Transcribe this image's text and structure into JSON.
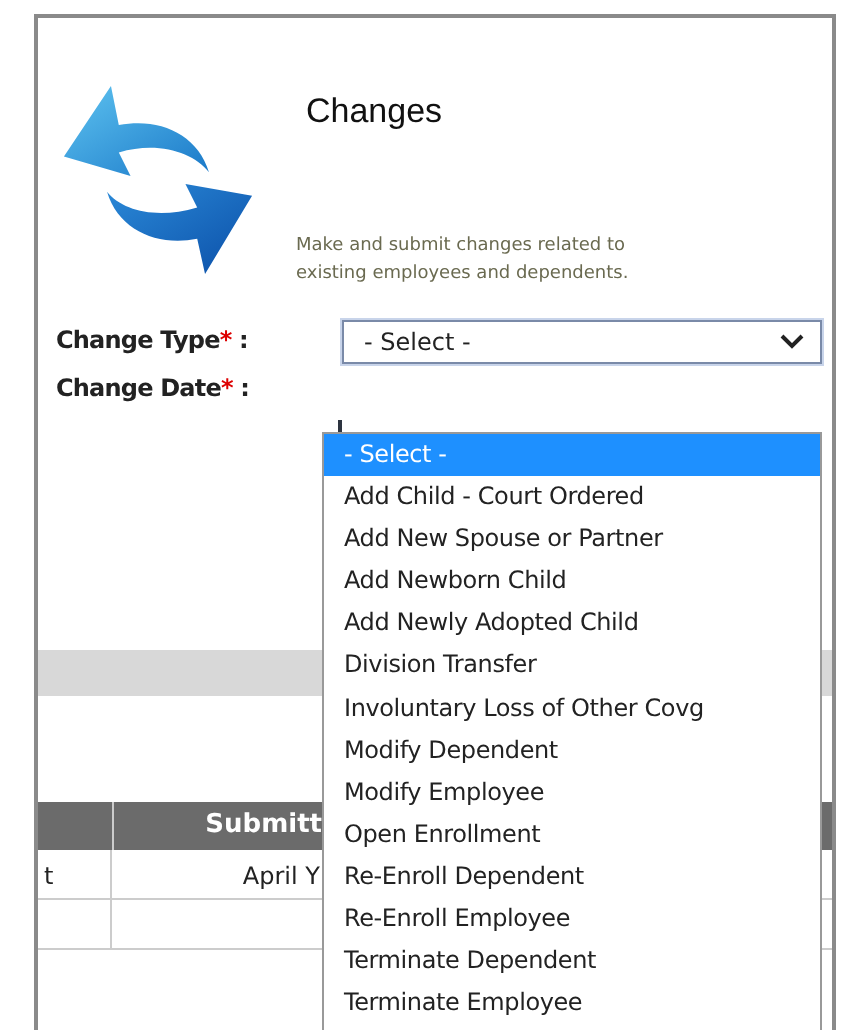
{
  "title": "Changes",
  "description": "Make and submit changes related to existing employees and dependents.",
  "fields": [
    {
      "label": "Change Type",
      "required_mark": "*",
      "colon": ":"
    },
    {
      "label": "Change Date",
      "required_mark": "*",
      "colon": ":"
    }
  ],
  "select": {
    "value": "- Select -",
    "expanded": true,
    "options": [
      {
        "label": "- Select -",
        "selected": true
      },
      {
        "label": "Add Child - Court Ordered",
        "selected": false
      },
      {
        "label": "Add New Spouse or Partner",
        "selected": false
      },
      {
        "label": "Add Newborn Child",
        "selected": false
      },
      {
        "label": "Add Newly Adopted Child",
        "selected": false
      },
      {
        "label": "Division Transfer",
        "selected": false
      },
      {
        "label": "Involuntary Loss of Other Covg",
        "selected": false
      },
      {
        "label": "Modify Dependent",
        "selected": false
      },
      {
        "label": "Modify Employee",
        "selected": false
      },
      {
        "label": "Open Enrollment",
        "selected": false
      },
      {
        "label": "Re-Enroll Dependent",
        "selected": false
      },
      {
        "label": "Re-Enroll Employee",
        "selected": false
      },
      {
        "label": "Terminate Dependent",
        "selected": false
      },
      {
        "label": "Terminate Employee",
        "selected": false
      }
    ]
  },
  "table": {
    "column_2": "Submitt",
    "rows": [
      {
        "column_1": "t",
        "column_2": "April Y"
      }
    ]
  }
}
